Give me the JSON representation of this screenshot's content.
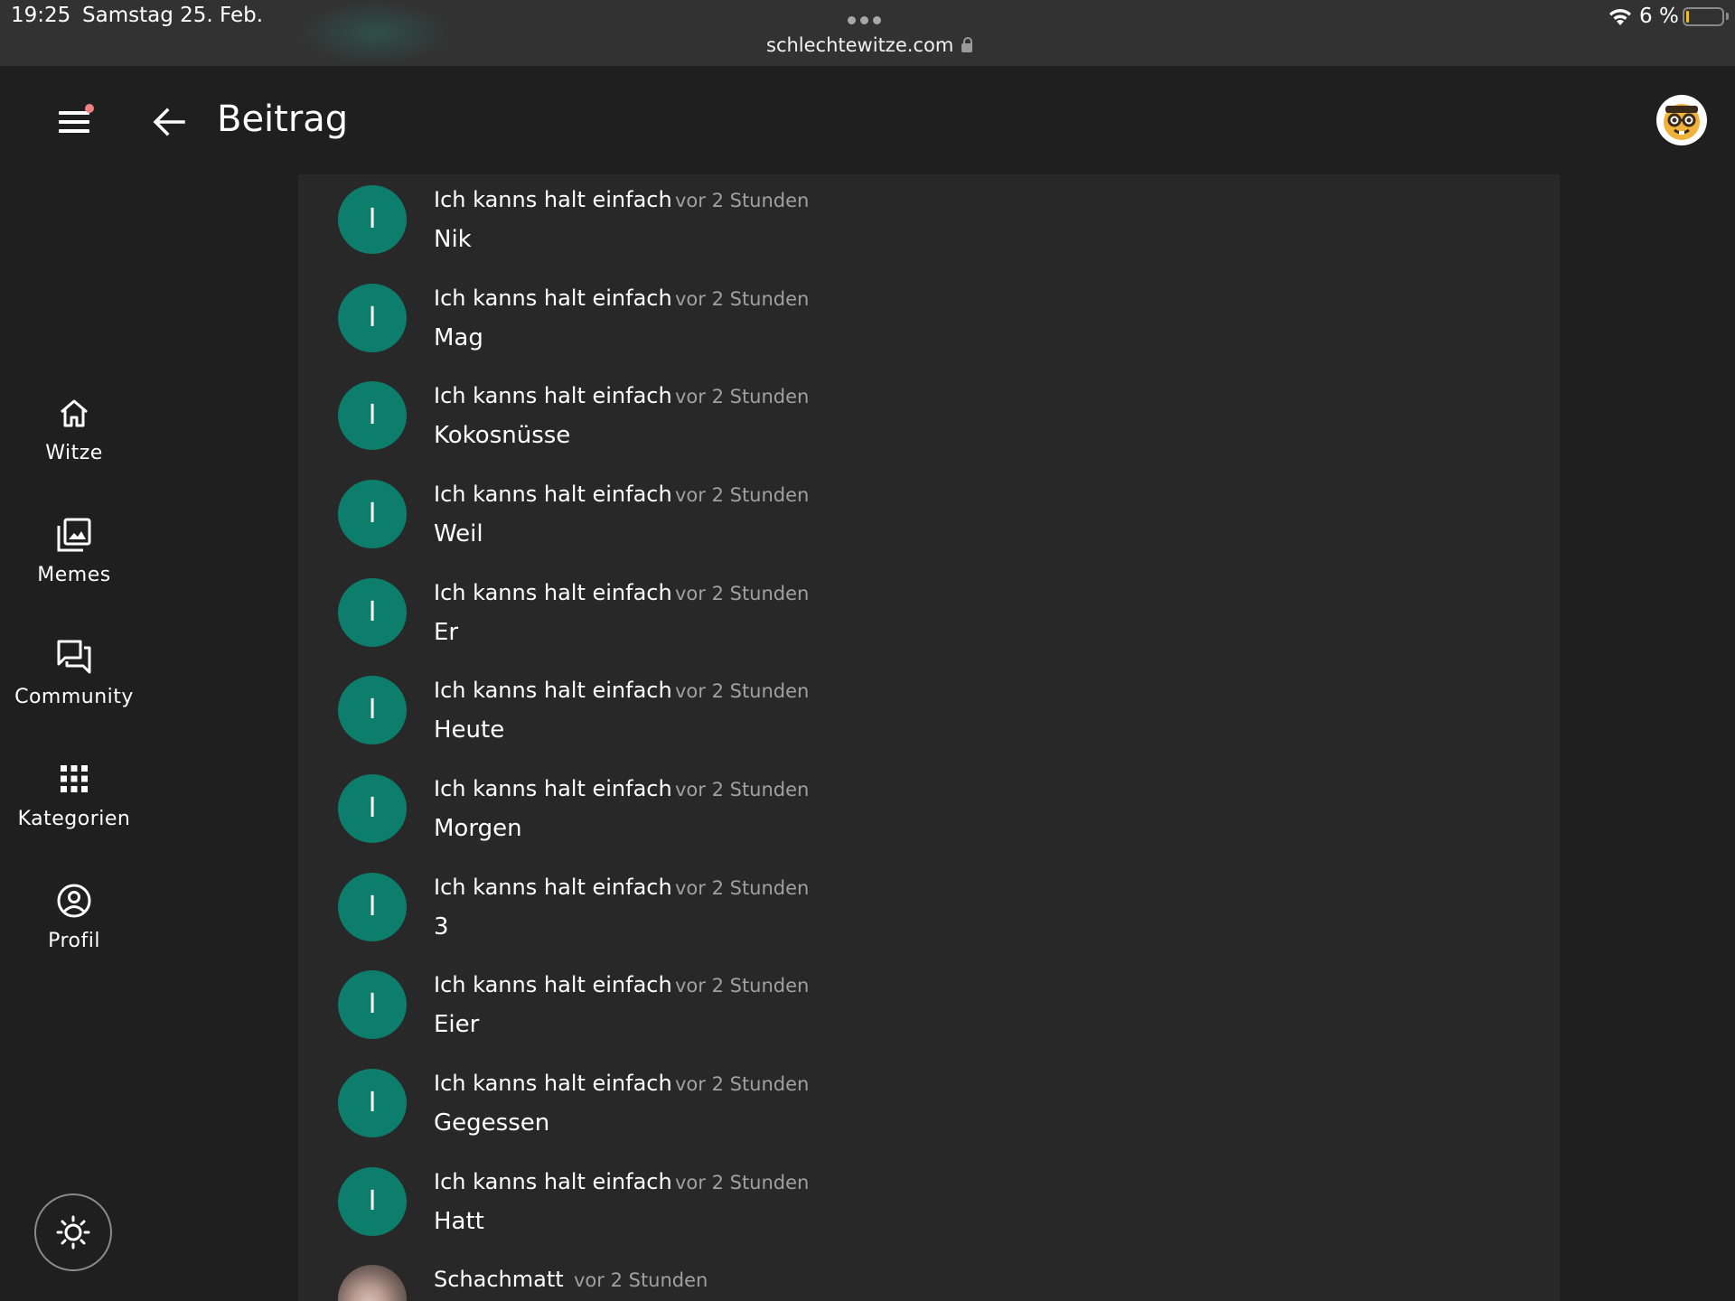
{
  "status_bar": {
    "time": "19:25",
    "date": "Samstag 25. Feb.",
    "url": "schlechtewitze.com",
    "battery": "6 %"
  },
  "app_bar": {
    "title": "Beitrag",
    "has_notification": true
  },
  "sidebar": {
    "items": [
      {
        "label": "Witze",
        "icon": "home-icon"
      },
      {
        "label": "Memes",
        "icon": "image-library-icon"
      },
      {
        "label": "Community",
        "icon": "forum-icon"
      },
      {
        "label": "Kategorien",
        "icon": "grid-icon"
      },
      {
        "label": "Profil",
        "icon": "account-circle-icon"
      }
    ],
    "theme_toggle_icon": "brightness-icon"
  },
  "comments": [
    {
      "initial": "I",
      "author": "Ich kanns halt einfach",
      "time": "vor 2 Stunden",
      "text": "Nik"
    },
    {
      "initial": "I",
      "author": "Ich kanns halt einfach",
      "time": "vor 2 Stunden",
      "text": "Mag"
    },
    {
      "initial": "I",
      "author": "Ich kanns halt einfach",
      "time": "vor 2 Stunden",
      "text": "Kokosnüsse"
    },
    {
      "initial": "I",
      "author": "Ich kanns halt einfach",
      "time": "vor 2 Stunden",
      "text": "Weil"
    },
    {
      "initial": "I",
      "author": "Ich kanns halt einfach",
      "time": "vor 2 Stunden",
      "text": "Er"
    },
    {
      "initial": "I",
      "author": "Ich kanns halt einfach",
      "time": "vor 2 Stunden",
      "text": "Heute"
    },
    {
      "initial": "I",
      "author": "Ich kanns halt einfach",
      "time": "vor 2 Stunden",
      "text": "Morgen"
    },
    {
      "initial": "I",
      "author": "Ich kanns halt einfach",
      "time": "vor 2 Stunden",
      "text": "3"
    },
    {
      "initial": "I",
      "author": "Ich kanns halt einfach",
      "time": "vor 2 Stunden",
      "text": "Eier"
    },
    {
      "initial": "I",
      "author": "Ich kanns halt einfach",
      "time": "vor 2 Stunden",
      "text": "Gegessen"
    },
    {
      "initial": "I",
      "author": "Ich kanns halt einfach",
      "time": "vor 2 Stunden",
      "text": "Hatt"
    },
    {
      "author": "Schachmatt",
      "time": "vor 2 Stunden",
      "text": ""
    }
  ],
  "colors": {
    "avatar_teal": "#0d7d6c",
    "background": "#1f1f1f",
    "content_surface": "#282828",
    "status_bar": "#323232",
    "muted_text": "#a0a0a0"
  }
}
